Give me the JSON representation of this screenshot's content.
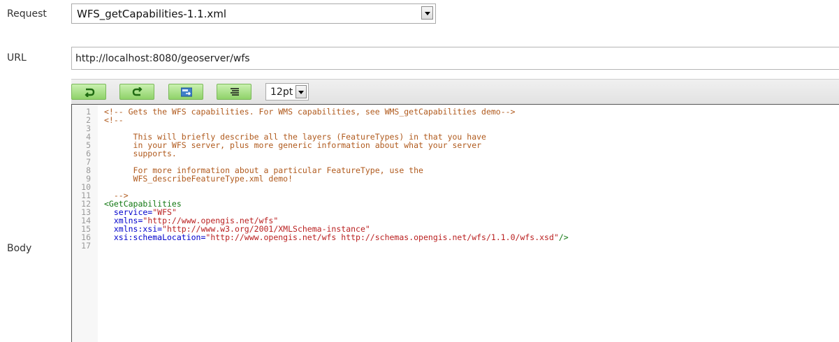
{
  "labels": {
    "request": "Request",
    "url": "URL",
    "body": "Body"
  },
  "request_select": {
    "value": "WFS_getCapabilities-1.1.xml"
  },
  "url_field": {
    "value": "http://localhost:8080/geoserver/wfs"
  },
  "toolbar": {
    "buttons": [
      {
        "name": "undo-icon"
      },
      {
        "name": "redo-icon"
      },
      {
        "name": "validate-icon"
      },
      {
        "name": "format-icon"
      }
    ],
    "font_size": "12pt"
  },
  "editor": {
    "lines": [
      {
        "n": "1",
        "parts": [
          {
            "t": "<!-- Gets the WFS capabilities. For WMS capabilities, see WMS_getCapabilities demo-->",
            "c": "c-comment"
          }
        ]
      },
      {
        "n": "2",
        "parts": [
          {
            "t": "<!--",
            "c": "c-comment"
          }
        ]
      },
      {
        "n": "3",
        "parts": []
      },
      {
        "n": "4",
        "parts": [
          {
            "t": "      This will briefly describe all the layers (FeatureTypes) in that you have",
            "c": "c-comment"
          }
        ]
      },
      {
        "n": "5",
        "parts": [
          {
            "t": "      in your WFS server, plus more generic information about what your server",
            "c": "c-comment"
          }
        ]
      },
      {
        "n": "6",
        "parts": [
          {
            "t": "      supports.",
            "c": "c-comment"
          }
        ]
      },
      {
        "n": "7",
        "parts": []
      },
      {
        "n": "8",
        "parts": [
          {
            "t": "      For more information about a particular FeatureType, use the",
            "c": "c-comment"
          }
        ]
      },
      {
        "n": "9",
        "parts": [
          {
            "t": "      WFS_describeFeatureType.xml demo!",
            "c": "c-comment"
          }
        ]
      },
      {
        "n": "10",
        "parts": []
      },
      {
        "n": "11",
        "parts": [
          {
            "t": "  -->",
            "c": "c-comment"
          }
        ]
      },
      {
        "n": "12",
        "parts": [
          {
            "t": "<GetCapabilities",
            "c": "c-tag"
          }
        ]
      },
      {
        "n": "13",
        "parts": [
          {
            "t": "  service=",
            "c": "c-attr"
          },
          {
            "t": "\"WFS\"",
            "c": "c-val"
          }
        ]
      },
      {
        "n": "14",
        "parts": [
          {
            "t": "  xmlns=",
            "c": "c-attr"
          },
          {
            "t": "\"http://www.opengis.net/wfs\"",
            "c": "c-val"
          }
        ]
      },
      {
        "n": "15",
        "parts": [
          {
            "t": "  xmlns:xsi=",
            "c": "c-attr"
          },
          {
            "t": "\"http://www.w3.org/2001/XMLSchema-instance\"",
            "c": "c-val"
          }
        ]
      },
      {
        "n": "16",
        "parts": [
          {
            "t": "  xsi:schemaLocation=",
            "c": "c-attr"
          },
          {
            "t": "\"http://www.opengis.net/wfs http://schemas.opengis.net/wfs/1.1.0/wfs.xsd\"",
            "c": "c-val"
          },
          {
            "t": "/>",
            "c": "c-tag"
          }
        ]
      },
      {
        "n": "17",
        "parts": []
      }
    ]
  }
}
